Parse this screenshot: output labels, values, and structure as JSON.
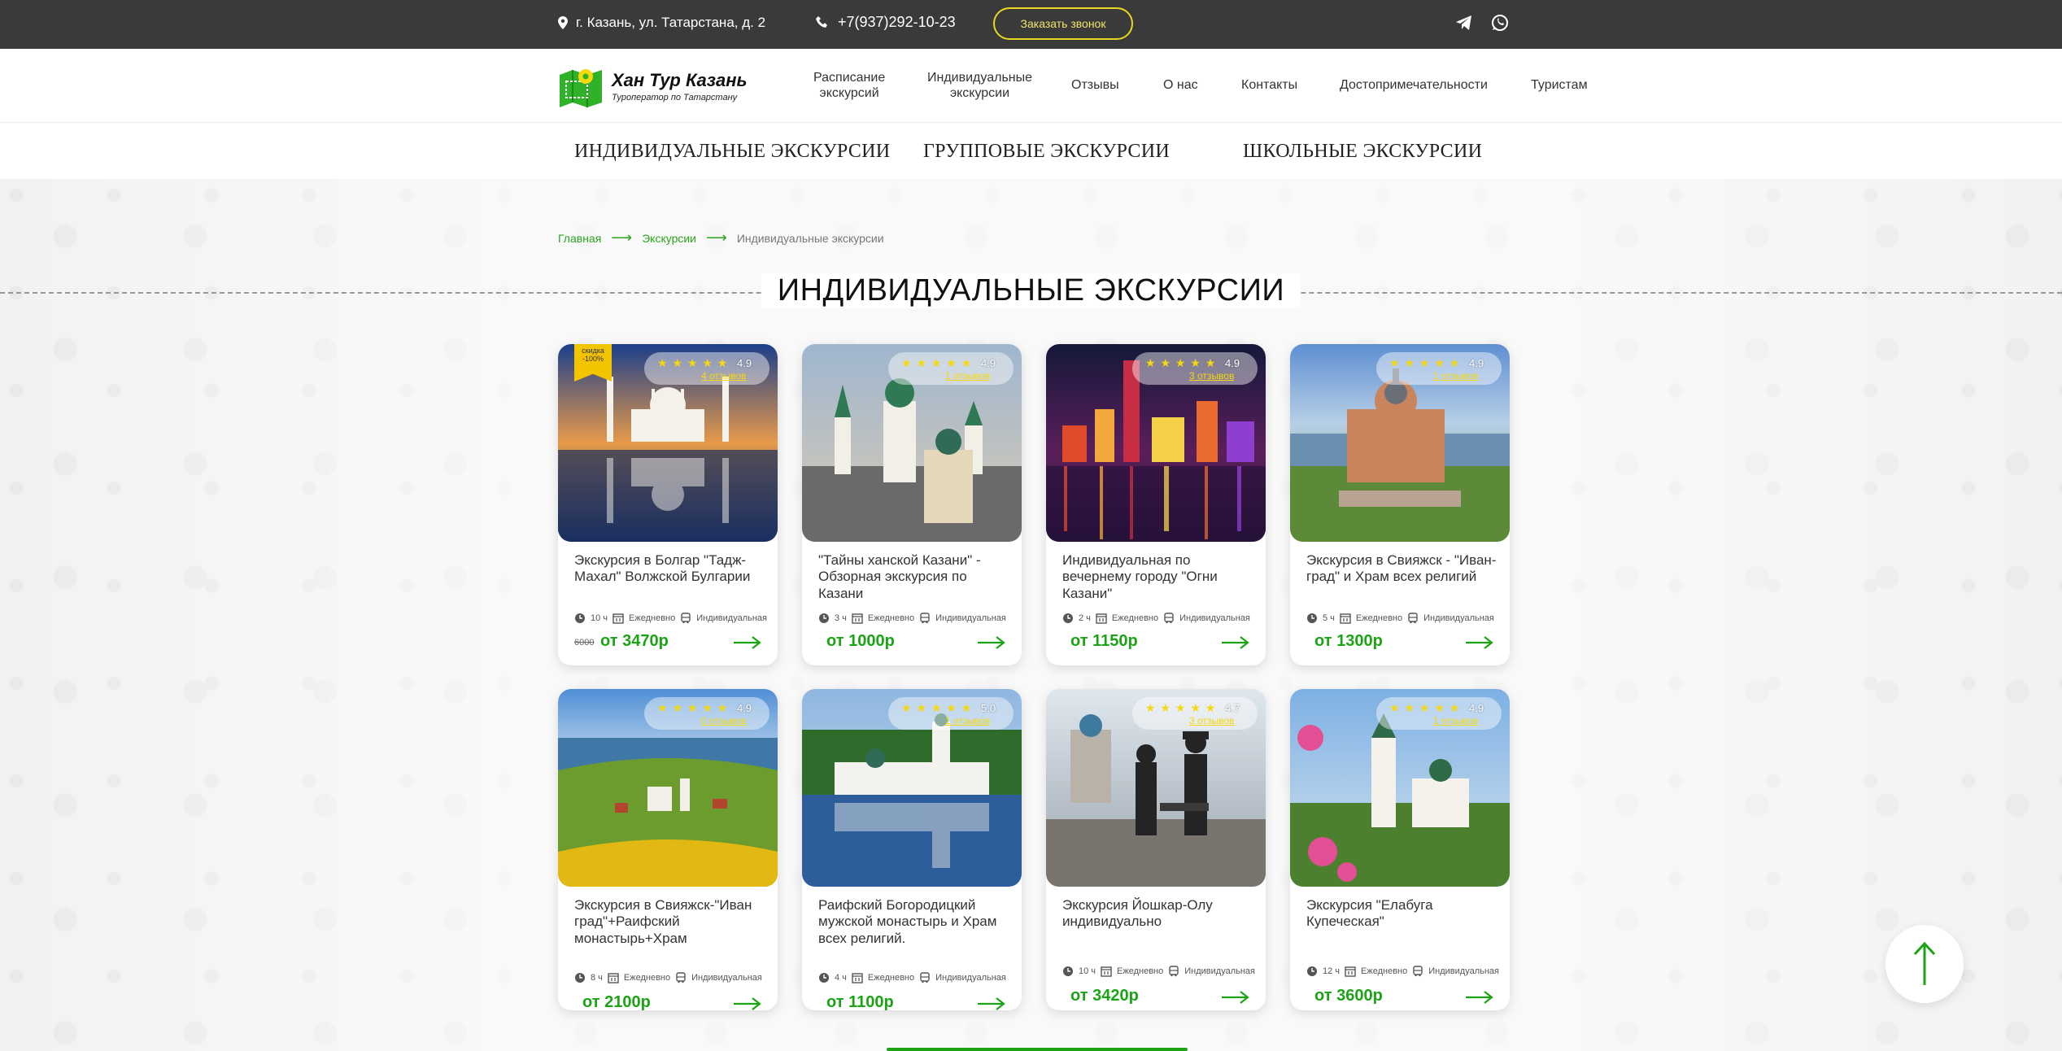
{
  "topbar": {
    "address": "г. Казань, ул. Татарстана, д. 2",
    "phone": "+7(937)292-10-23",
    "callback_label": "Заказать звонок"
  },
  "logo": {
    "title": "Хан Тур Казань",
    "subtitle": "Туроператор по Татарстану"
  },
  "nav": {
    "items": [
      {
        "line1": "Расписание",
        "line2": "экскурсий"
      },
      {
        "line1": "Индивидуальные",
        "line2": "экскурсии"
      },
      {
        "line1": "Отзывы",
        "line2": ""
      },
      {
        "line1": "О нас",
        "line2": ""
      },
      {
        "line1": "Контакты",
        "line2": ""
      },
      {
        "line1": "Достопримечательности",
        "line2": ""
      },
      {
        "line1": "Туристам",
        "line2": ""
      }
    ]
  },
  "categories": [
    "ИНДИВИДУАЛЬНЫЕ ЭКСКУРСИИ",
    "ГРУППОВЫЕ ЭКСКУРСИИ",
    "ШКОЛЬНЫЕ ЭКСКУРСИИ"
  ],
  "breadcrumb": {
    "home": "Главная",
    "section": "Экскурсии",
    "current": "Индивидуальные экскурсии"
  },
  "page_title": "ИНДИВИДУАЛЬНЫЕ ЭКСКУРСИИ",
  "stars": "★ ★ ★ ★ ★",
  "meta_labels": {
    "daily": "Ежедневно",
    "type": "Индивидуальная"
  },
  "badge": {
    "line1": "скидка",
    "line2": "-100%"
  },
  "cards": [
    {
      "title": "Экскурсия в Болгар \"Тадж-Махал\" Волжской Булгарии",
      "rating": "4.9",
      "reviews": "4 отзывов",
      "duration": "10 ч",
      "old_price": "6000",
      "price": "от 3470р"
    },
    {
      "title": "\"Тайны ханской Казани\" - Обзорная экскурсия по Казани",
      "rating": "4.9",
      "reviews": "1 отзывов",
      "duration": "3 ч",
      "old_price": "",
      "price": "от 1000р"
    },
    {
      "title": "Индивидуальная по вечернему городу \"Огни Казани\"",
      "rating": "4.9",
      "reviews": "3 отзывов",
      "duration": "2 ч",
      "old_price": "",
      "price": "от 1150р"
    },
    {
      "title": "Экскурсия в Свияжск - \"Иван-град\" и Храм всех религий",
      "rating": "4.9",
      "reviews": "1 отзывов",
      "duration": "5 ч",
      "old_price": "",
      "price": "от 1300р"
    },
    {
      "title": "Экскурсия в Свияжск-\"Иван град\"+Раифский монастырь+Храм",
      "rating": "4.9",
      "reviews": "0 отзывов",
      "duration": "8 ч",
      "old_price": "",
      "price": "от 2100р"
    },
    {
      "title": "Раифский Богородицкий мужской монастырь и Храм всех религий.",
      "rating": "5.0",
      "reviews": "1 отзывов",
      "duration": "4 ч",
      "old_price": "",
      "price": "от 1100р"
    },
    {
      "title": "Экскурсия Йошкар-Олу индивидуально",
      "rating": "4.7",
      "reviews": "3 отзывов",
      "duration": "10 ч",
      "old_price": "",
      "price": "от 3420р"
    },
    {
      "title": "Экскурсия \"Елабуга Купеческая\"",
      "rating": "4.9",
      "reviews": "1 отзывов",
      "duration": "12 ч",
      "old_price": "",
      "price": "от 3600р"
    }
  ],
  "colors": {
    "accent_green": "#1ca316",
    "topbar": "#3a3a3a",
    "callback_border": "#e7d81f",
    "star": "#f5d80d"
  }
}
